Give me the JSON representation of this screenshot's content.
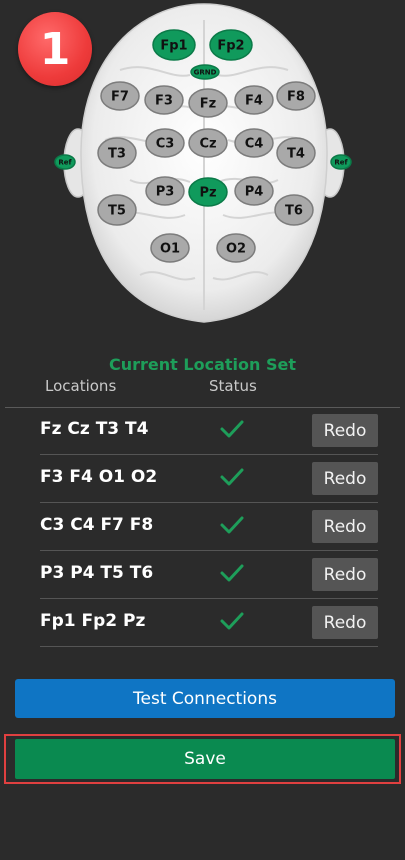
{
  "badge": {
    "number": "1"
  },
  "colors": {
    "active_electrode": "#109a5c",
    "inactive_electrode": "#a9a9a9",
    "accent_green": "#1e9e5a",
    "test_button": "#0f75c4",
    "save_button": "#0a8a50",
    "highlight": "#e04040"
  },
  "electrodes": [
    {
      "label": "Fp1",
      "active": true
    },
    {
      "label": "Fp2",
      "active": true
    },
    {
      "label": "GRND",
      "active": true
    },
    {
      "label": "F7",
      "active": false
    },
    {
      "label": "F3",
      "active": false
    },
    {
      "label": "Fz",
      "active": false
    },
    {
      "label": "F4",
      "active": false
    },
    {
      "label": "F8",
      "active": false
    },
    {
      "label": "Ref",
      "active": true
    },
    {
      "label": "T3",
      "active": false
    },
    {
      "label": "C3",
      "active": false
    },
    {
      "label": "Cz",
      "active": false
    },
    {
      "label": "C4",
      "active": false
    },
    {
      "label": "T4",
      "active": false
    },
    {
      "label": "Ref",
      "active": true
    },
    {
      "label": "P3",
      "active": false
    },
    {
      "label": "Pz",
      "active": true
    },
    {
      "label": "P4",
      "active": false
    },
    {
      "label": "T5",
      "active": false
    },
    {
      "label": "T6",
      "active": false
    },
    {
      "label": "O1",
      "active": false
    },
    {
      "label": "O2",
      "active": false
    }
  ],
  "location_set": {
    "title": "Current Location Set",
    "col_locations": "Locations",
    "col_status": "Status",
    "rows": [
      {
        "locations": "Fz Cz T3 T4",
        "status": "check-icon",
        "redo": "Redo"
      },
      {
        "locations": "F3 F4 O1 O2",
        "status": "check-icon",
        "redo": "Redo"
      },
      {
        "locations": "C3 C4 F7 F8",
        "status": "check-icon",
        "redo": "Redo"
      },
      {
        "locations": "P3 P4 T5 T6",
        "status": "check-icon",
        "redo": "Redo"
      },
      {
        "locations": "Fp1 Fp2 Pz",
        "status": "check-icon",
        "redo": "Redo"
      }
    ]
  },
  "buttons": {
    "test_connections": "Test Connections",
    "save": "Save"
  }
}
